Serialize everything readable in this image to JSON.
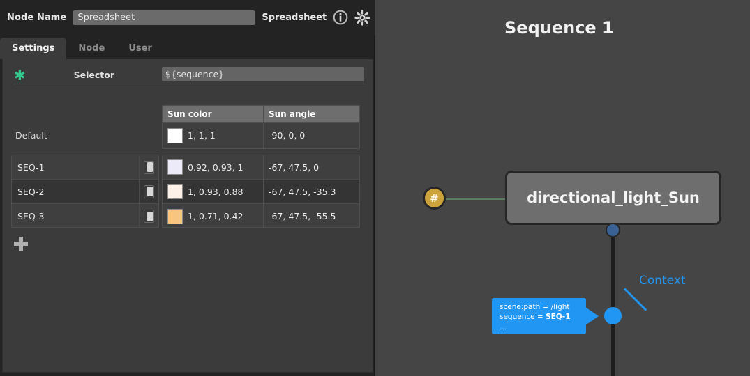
{
  "panel": {
    "header": {
      "node_name_label": "Node Name",
      "node_name_value": "Spreadsheet",
      "node_name_placeholder": "Node Name",
      "node_type": "Spreadsheet",
      "info_icon": "info-icon",
      "gear_icon": "gear-icon"
    },
    "tabs": [
      {
        "label": "Settings",
        "active": true
      },
      {
        "label": "Node",
        "active": false
      },
      {
        "label": "User",
        "active": false
      }
    ],
    "selector": {
      "asterisk_icon": "asterisk-icon",
      "label": "Selector",
      "value": "${sequence}",
      "placeholder": "${sequence}"
    },
    "sheet": {
      "columns": [
        "Sun color",
        "Sun angle"
      ],
      "default_row": {
        "label": "Default",
        "color_swatch": "#ffffff",
        "color_value": "1, 1, 1",
        "angle_value": "-90, 0, 0"
      },
      "rows": [
        {
          "label": "SEQ-1",
          "enabled": true,
          "color_swatch": "#eceaf8",
          "color_value": "0.92, 0.93, 1",
          "angle_value": "-67, 47.5, 0"
        },
        {
          "label": "SEQ-2",
          "enabled": true,
          "color_swatch": "#fdf0e6",
          "color_value": "1, 0.93, 0.88",
          "angle_value": "-67, 47.5, -35.3"
        },
        {
          "label": "SEQ-3",
          "enabled": true,
          "color_swatch": "#f8c581",
          "color_value": "1, 0.71, 0.42",
          "angle_value": "-67, 47.5, -55.5"
        }
      ],
      "add_row_icon": "plus-icon"
    }
  },
  "graph": {
    "title": "Sequence 1",
    "hash_badge": "#",
    "node": {
      "label": "directional_light_Sun"
    },
    "context_bubble": {
      "line1": "scene:path = /light",
      "line2_prefix": "sequence = ",
      "line2_value": "SEQ-1",
      "line3": "..."
    },
    "annotation": {
      "label": "Context"
    }
  },
  "colors": {
    "accent_blue": "#2196f3",
    "badge_gold": "#cda43c",
    "asterisk_green": "#35c88f",
    "panel_bg": "#3b3b3b",
    "graph_bg": "#454545"
  }
}
